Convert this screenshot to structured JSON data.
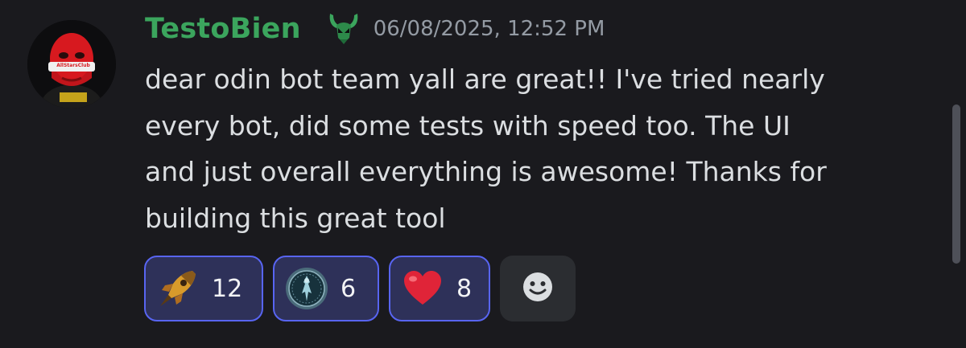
{
  "message": {
    "username": "TestoBien",
    "timestamp": "06/08/2025, 12:52 PM",
    "avatar": {
      "description_icon": "avatar-red-balaclava",
      "text": "AllStarsClub"
    },
    "role_icon": "horned-helmet-icon",
    "content_lines": [
      "dear odin bot team yall are great!! I've tried nearly",
      "every bot, did some tests with speed too. The UI",
      "and just overall everything is awesome! Thanks for",
      "building this great tool"
    ]
  },
  "reactions": [
    {
      "icon": "rocket-icon",
      "count": "12"
    },
    {
      "icon": "odin-coin-icon",
      "count": "6"
    },
    {
      "icon": "red-heart-icon",
      "count": "8"
    }
  ],
  "add_reaction": {
    "icon": "smiley-add-reaction-icon"
  },
  "colors": {
    "background": "#1a1a1e",
    "username": "#3ba55d",
    "timestamp": "#949ba4",
    "text": "#dbdee1",
    "reaction_bg": "#2e3159",
    "reaction_border": "#5865f2",
    "add_reaction_bg": "#2b2d31",
    "scrollbar": "#4e5058"
  }
}
